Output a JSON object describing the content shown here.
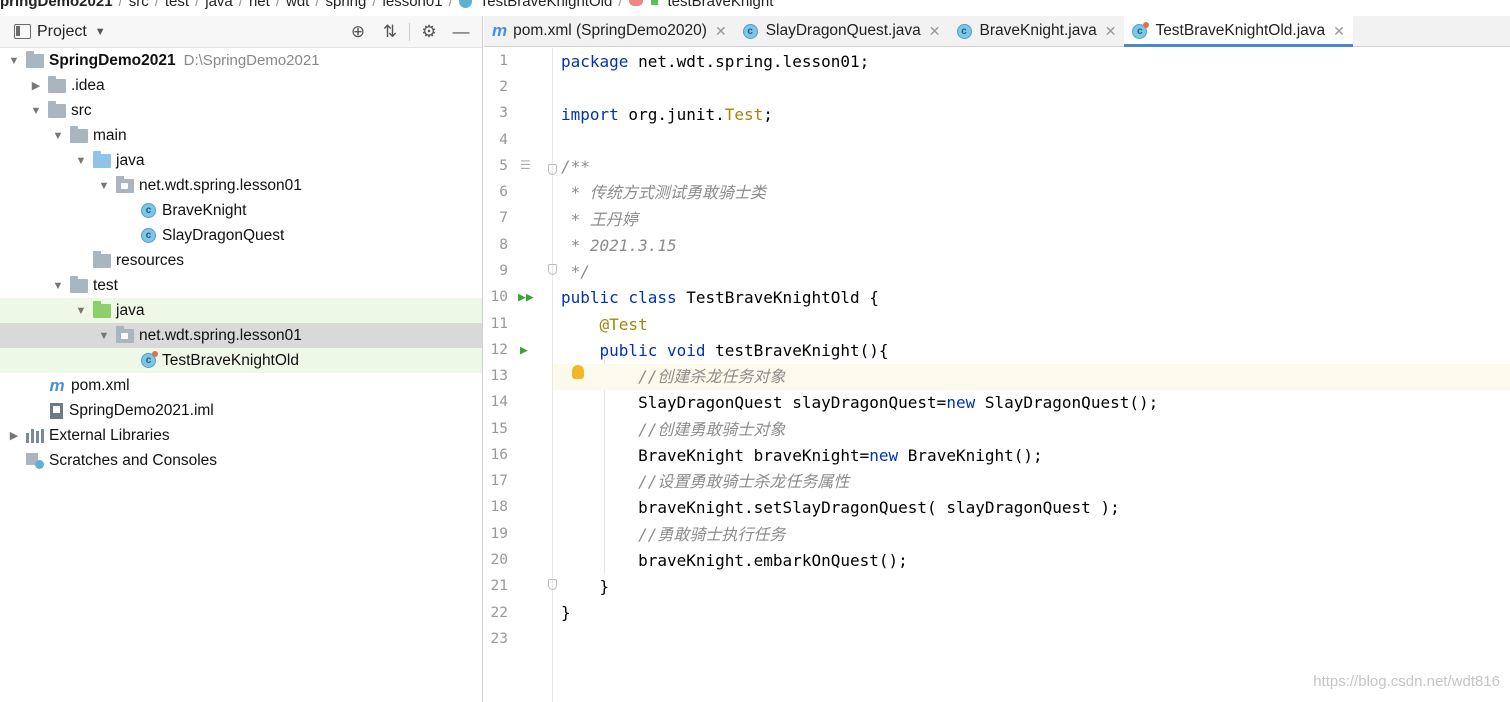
{
  "breadcrumb": {
    "items": [
      "pringDemo2021",
      "src",
      "test",
      "java",
      "net",
      "wdt",
      "spring",
      "lesson01",
      "TestBraveKnightOld",
      "testBraveKnight"
    ]
  },
  "project_panel": {
    "title": "Project",
    "tree": [
      {
        "label": "SpringDemo2021",
        "path": "D:\\SpringDemo2021"
      },
      {
        "label": ".idea"
      },
      {
        "label": "src"
      },
      {
        "label": "main"
      },
      {
        "label": "java"
      },
      {
        "label": "net.wdt.spring.lesson01"
      },
      {
        "label": "BraveKnight"
      },
      {
        "label": "SlayDragonQuest"
      },
      {
        "label": "resources"
      },
      {
        "label": "test"
      },
      {
        "label": "java"
      },
      {
        "label": "net.wdt.spring.lesson01"
      },
      {
        "label": "TestBraveKnightOld"
      },
      {
        "label": "pom.xml"
      },
      {
        "label": "SpringDemo2021.iml"
      },
      {
        "label": "External Libraries"
      },
      {
        "label": "Scratches and Consoles"
      }
    ]
  },
  "tabs": [
    {
      "label": "pom.xml (SpringDemo2020)",
      "icon": "maven-icon"
    },
    {
      "label": "SlayDragonQuest.java",
      "icon": "class-icon"
    },
    {
      "label": "BraveKnight.java",
      "icon": "class-icon"
    },
    {
      "label": "TestBraveKnightOld.java",
      "icon": "test-class-icon"
    }
  ],
  "editor": {
    "line_numbers": [
      "1",
      "2",
      "3",
      "4",
      "5",
      "6",
      "7",
      "8",
      "9",
      "10",
      "11",
      "12",
      "13",
      "14",
      "15",
      "16",
      "17",
      "18",
      "19",
      "20",
      "21",
      "22",
      "23"
    ],
    "lines": {
      "l1a": "package",
      "l1b": " net.wdt.spring.lesson01;",
      "l3a": "import",
      "l3b": " org.junit.",
      "l3c": "Test",
      "l3d": ";",
      "l5": "/**",
      "l6": " * 传统方式测试勇敢骑士类",
      "l7": " * 王丹婷",
      "l8": " * 2021.3.15",
      "l9": " */",
      "l10a": "public class",
      "l10b": " TestBraveKnightOld {",
      "l11": "    @Test",
      "l12a": "    public void",
      "l12b": " testBraveKnight(){",
      "l13": "        //创建杀龙任务对象",
      "l14a": "        SlayDragonQuest slayDragonQuest=",
      "l14b": "new",
      "l14c": " SlayDragonQuest();",
      "l15": "        //创建勇敢骑士对象",
      "l16a": "        BraveKnight braveKnight=",
      "l16b": "new",
      "l16c": " BraveKnight();",
      "l17": "        //设置勇敢骑士杀龙任务属性",
      "l18": "        braveKnight.setSlayDragonQuest( slayDragonQuest );",
      "l19": "        //勇敢骑士执行任务",
      "l20": "        braveKnight.embarkOnQuest();",
      "l21": "    }",
      "l22": "}"
    },
    "current_line": "13"
  },
  "watermark": "https://blog.csdn.net/wdt816"
}
